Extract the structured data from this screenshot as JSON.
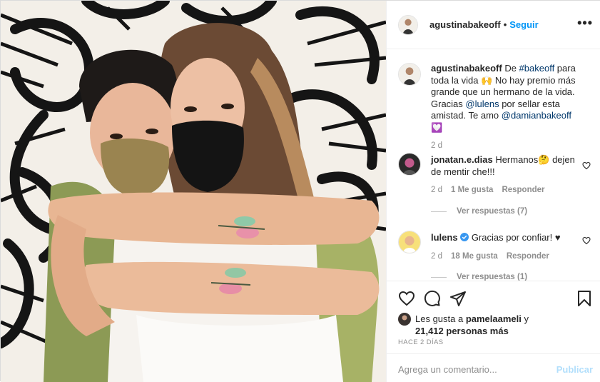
{
  "header": {
    "username": "agustinabakeoff",
    "separator": "•",
    "follow_label": "Seguir",
    "more_label": "•••",
    "avatar_icon": "profile-avatar"
  },
  "caption": {
    "username": "agustinabakeoff",
    "part1": "De ",
    "hashtag": "#bakeoff",
    "part2": " para toda la vida 🙌 No hay premio más grande que un hermano de la vida. Gracias ",
    "mention1": "@lulens",
    "part3": " por sellar esta amistad. Te amo ",
    "mention2": "@damianbakeoff",
    "emoji_end": "💟",
    "time": "2 d"
  },
  "comments": [
    {
      "username": "jonatan.e.dias",
      "text": " Hermanos🤔 dejen de mentir che!!!",
      "time": "2 d",
      "likes": "1 Me gusta",
      "reply_label": "Responder",
      "view_replies": "Ver respuestas (7)"
    },
    {
      "username": "lulens",
      "verified_icon": "verified-badge-icon",
      "text": " Gracias por confiar! ♥",
      "time": "2 d",
      "likes": "18 Me gusta",
      "reply_label": "Responder",
      "view_replies": "Ver respuestas (1)"
    }
  ],
  "actions": {
    "icons": [
      "heart-icon",
      "comment-icon",
      "share-icon",
      "bookmark-icon"
    ],
    "likes_prefix": "Les gusta a ",
    "likes_user": "pamelaameli",
    "likes_suffix": " y",
    "likes_count": "21,412 personas más",
    "time_ago": "HACE 2 DÍAS"
  },
  "add_comment": {
    "placeholder": "Agrega un comentario...",
    "publish_label": "Publicar"
  },
  "colors": {
    "accent": "#0095f6",
    "link": "#00376b",
    "muted": "#8e8e8e",
    "publish_disabled": "#b2dffc"
  }
}
